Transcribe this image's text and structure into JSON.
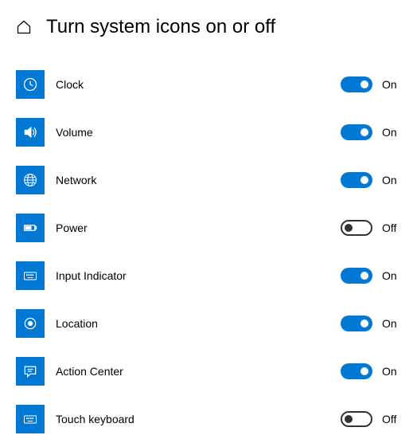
{
  "title": "Turn system icons on or off",
  "labels": {
    "on": "On",
    "off": "Off"
  },
  "colors": {
    "accent": "#0078d4"
  },
  "items": [
    {
      "id": "clock",
      "label": "Clock",
      "icon": "clock-icon",
      "state": true
    },
    {
      "id": "volume",
      "label": "Volume",
      "icon": "volume-icon",
      "state": true
    },
    {
      "id": "network",
      "label": "Network",
      "icon": "network-icon",
      "state": true
    },
    {
      "id": "power",
      "label": "Power",
      "icon": "power-icon",
      "state": false
    },
    {
      "id": "input-indicator",
      "label": "Input Indicator",
      "icon": "keyboard-icon",
      "state": true
    },
    {
      "id": "location",
      "label": "Location",
      "icon": "location-icon",
      "state": true
    },
    {
      "id": "action-center",
      "label": "Action Center",
      "icon": "action-center-icon",
      "state": true
    },
    {
      "id": "touch-keyboard",
      "label": "Touch keyboard",
      "icon": "touch-keyboard-icon",
      "state": false
    }
  ]
}
